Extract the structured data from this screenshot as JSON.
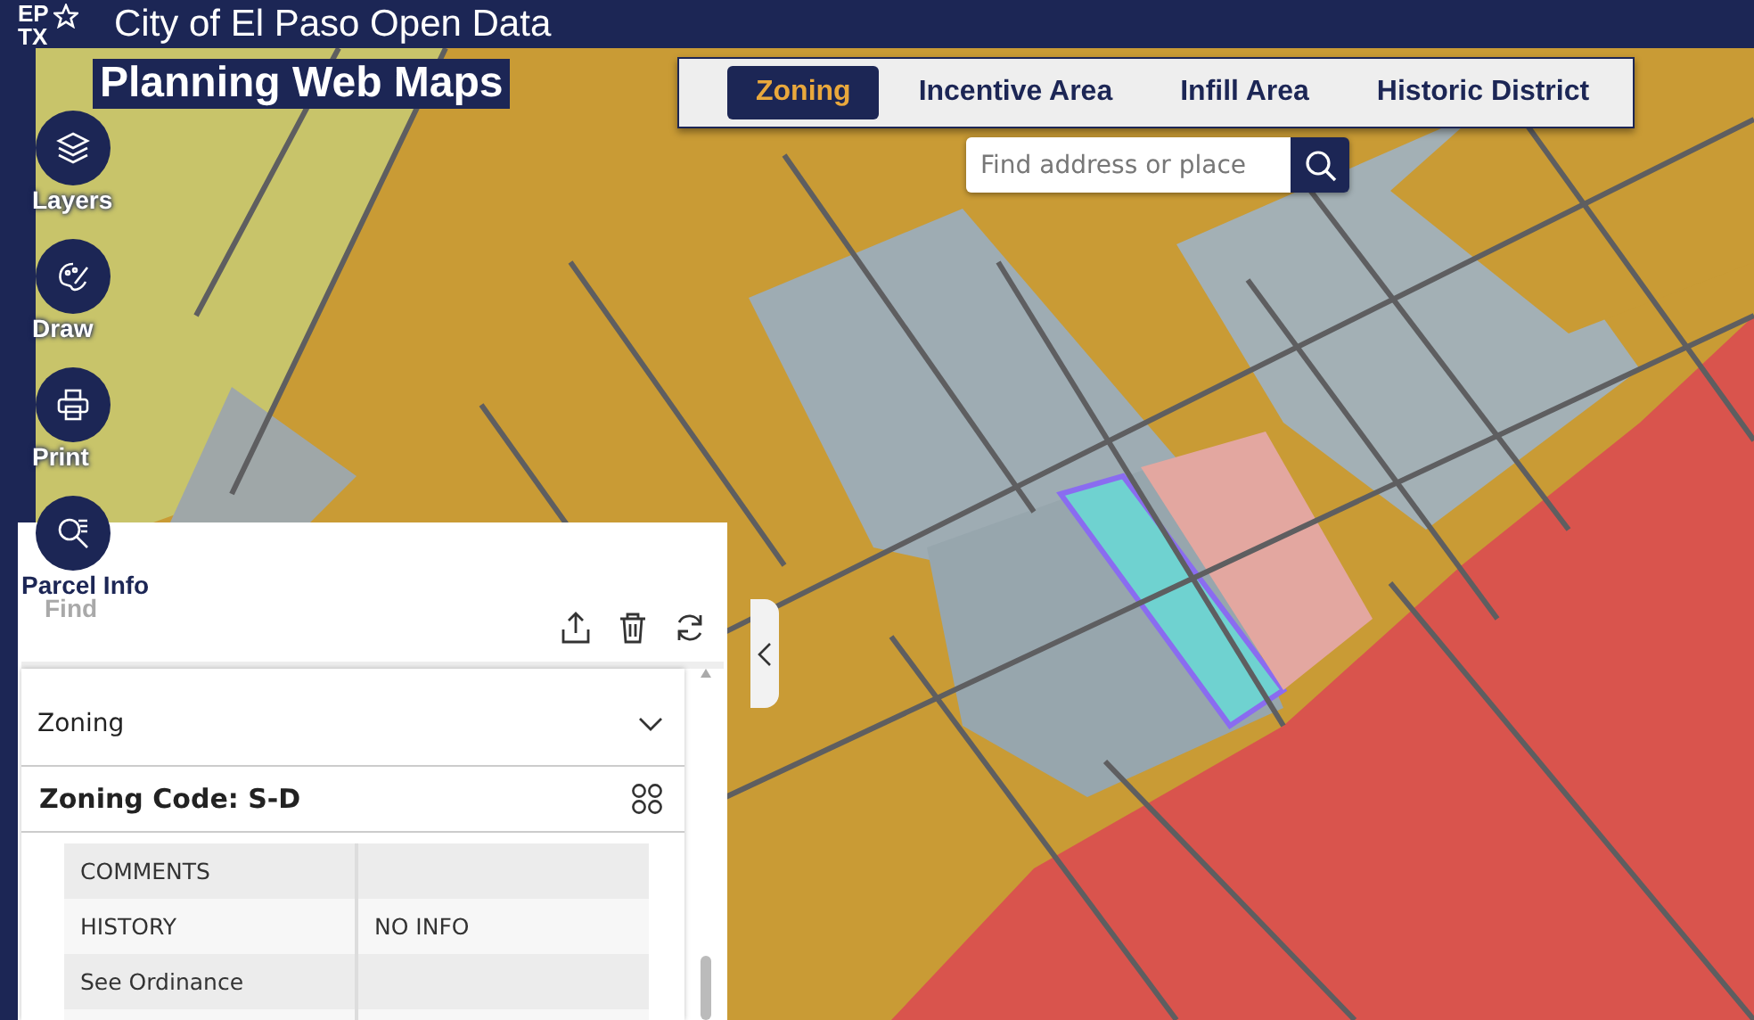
{
  "header": {
    "logo_text": [
      "EP",
      "TX"
    ],
    "site_title": "City of El Paso Open Data",
    "app_title": "Planning Web Maps"
  },
  "tabs": [
    {
      "label": "Zoning",
      "selected": true
    },
    {
      "label": "Incentive Area",
      "selected": false
    },
    {
      "label": "Infill Area",
      "selected": false
    },
    {
      "label": "Historic District",
      "selected": false
    }
  ],
  "search": {
    "placeholder": "Find address or place"
  },
  "tools": [
    {
      "label": "Layers",
      "kind": "layers",
      "selected": false
    },
    {
      "label": "Draw",
      "kind": "draw",
      "selected": false
    },
    {
      "label": "Print",
      "kind": "print",
      "selected": false
    },
    {
      "label": "Parcel Info",
      "kind": "parcel",
      "selected": true
    }
  ],
  "panel": {
    "faded_label": "Find",
    "section": {
      "title": "Zoning",
      "expanded": true
    },
    "feature_title": "Zoning Code: S-D",
    "rows": [
      {
        "field": "COMMENTS"
      },
      {
        "field": "HISTORY",
        "value": "NO INFO"
      },
      {
        "field": "See Ordinance"
      }
    ]
  }
}
